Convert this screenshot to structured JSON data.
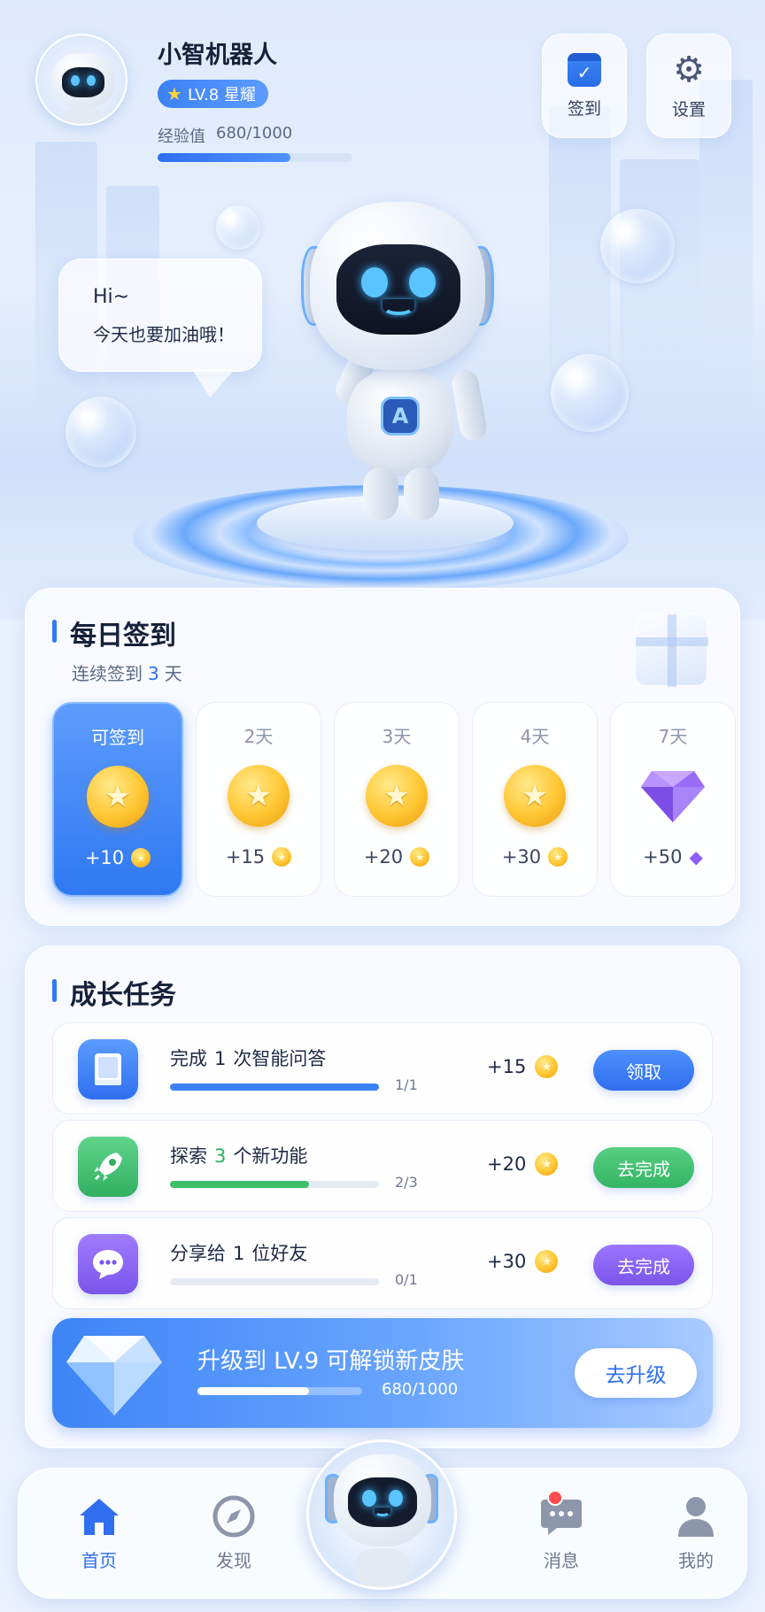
{
  "profile": {
    "name": "小智机器人",
    "level_label": "LV.8 星耀",
    "exp_label": "经验值",
    "exp_value": "680/1000",
    "exp_fraction": 0.68
  },
  "header_buttons": {
    "checkin_label": "签到",
    "settings_label": "设置"
  },
  "speech": {
    "line1": "Hi~",
    "line2": "今天也要加油哦！"
  },
  "checkin": {
    "title": "每日签到",
    "streak_prefix": "连续签到",
    "streak_days": "3",
    "streak_suffix": "天",
    "days": [
      {
        "label": "可签到",
        "reward": "+10",
        "icon": "coin-icon"
      },
      {
        "label": "2天",
        "reward": "+15",
        "icon": "coin-icon"
      },
      {
        "label": "3天",
        "reward": "+20",
        "icon": "coin-icon"
      },
      {
        "label": "4天",
        "reward": "+30",
        "icon": "coin-icon"
      },
      {
        "label": "7天",
        "reward": "+50",
        "icon": "diamond-icon"
      }
    ]
  },
  "tasks": {
    "title": "成长任务",
    "items": [
      {
        "name_a": "完成",
        "name_num": "1",
        "name_b": "次智能问答",
        "progress": "1/1",
        "fraction": 1.0,
        "reward": "+15",
        "button": "领取",
        "color": "#3b82f6",
        "icon": "book-icon"
      },
      {
        "name_a": "探索",
        "name_num": "3",
        "name_b": "个新功能",
        "progress": "2/3",
        "fraction": 0.667,
        "reward": "+20",
        "button": "去完成",
        "color": "#3fbf6a",
        "icon": "rocket-icon"
      },
      {
        "name_a": "分享给",
        "name_num": "1",
        "name_b": "位好友",
        "progress": "0/1",
        "fraction": 0.0,
        "reward": "+30",
        "button": "去完成",
        "color": "#8b63f0",
        "icon": "chat-bubble-icon"
      }
    ],
    "upgrade": {
      "text": "升级到 LV.9 可解锁新皮肤",
      "progress": "680/1000",
      "fraction": 0.68,
      "button": "去升级"
    }
  },
  "nav": {
    "home": "首页",
    "discover": "发现",
    "messages": "消息",
    "mine": "我的"
  },
  "colors": {
    "accent": "#2f6ff0",
    "green": "#3fbf6a",
    "purple": "#8b63f0",
    "coin": "#ffc632",
    "badge": "#ff4d4f"
  }
}
